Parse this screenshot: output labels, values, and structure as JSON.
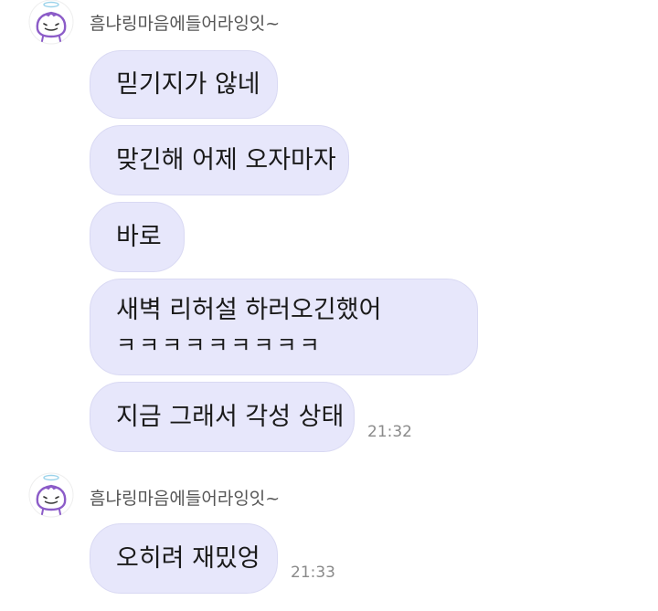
{
  "chat": {
    "groups": [
      {
        "sender": "흠냐링마음에들어라잉잇~",
        "messages": [
          {
            "text": "믿기지가 않네"
          },
          {
            "text": "맞긴해 어제 오자마자"
          },
          {
            "text": "바로"
          },
          {
            "text": "새벽 리허설 하러오긴했어",
            "text2": "ㅋㅋㅋㅋㅋㅋㅋㅋㅋ"
          },
          {
            "text": "지금 그래서 각성 상태",
            "time": "21:32"
          }
        ]
      },
      {
        "sender": "흠냐링마음에들어라잉잇~",
        "messages": [
          {
            "text": "오히려 재밌엉",
            "time": "21:33"
          }
        ]
      }
    ]
  },
  "colors": {
    "bubble_bg": "#e7e7fb",
    "avatar_accent": "#8c5cc8"
  },
  "icons": {
    "avatar": "cartoon-face-with-halo-avatar-icon"
  }
}
